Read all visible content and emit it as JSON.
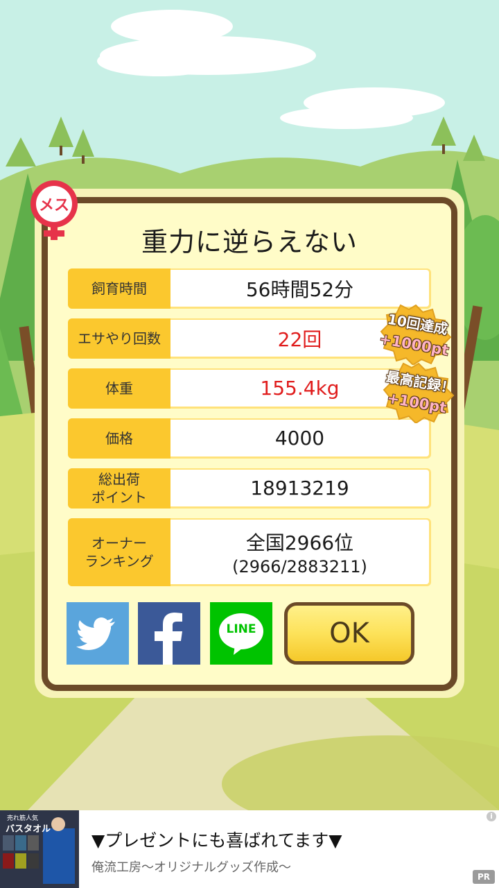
{
  "title": "重力に逆らえない",
  "sex_badge": "メス",
  "stats": [
    {
      "label": "飼育時間",
      "value": "56時間52分",
      "highlight": false
    },
    {
      "label": "エサやり回数",
      "value": "22回",
      "highlight": true
    },
    {
      "label": "体重",
      "value": "155.4kg",
      "highlight": true
    },
    {
      "label": "価格",
      "value": "4000",
      "highlight": false
    },
    {
      "label_line1": "総出荷",
      "label_line2": "ポイント",
      "value": "18913219",
      "highlight": false
    },
    {
      "label_line1": "オーナー",
      "label_line2": "ランキング",
      "value": "全国2966位",
      "value_sub": "(2966/2883211)",
      "highlight": false
    }
  ],
  "bonuses": [
    {
      "line1": "10回達成",
      "line2": "+1000pt"
    },
    {
      "line1": "最高記録！",
      "line2": "+100pt"
    }
  ],
  "social": {
    "twitter_icon": "twitter-bird-icon",
    "facebook_icon": "facebook-f-icon",
    "line_label": "LINE"
  },
  "ok_label": "OK",
  "ad": {
    "title": "▼プレゼントにも喜ばれてます▼",
    "subtitle": "俺流工房〜オリジナルグッズ作成〜",
    "image_caption_top": "売れ筋人気",
    "image_caption": "バスタオル",
    "info_mark": "i",
    "pr_label": "PR"
  },
  "colors": {
    "highlight": "#e01c1c",
    "label_bg": "#fbc82e",
    "frame": "#6b4a28",
    "twitter": "#5aa5dc",
    "facebook": "#3b5998",
    "line": "#00c300",
    "badge": "#e6334a"
  }
}
